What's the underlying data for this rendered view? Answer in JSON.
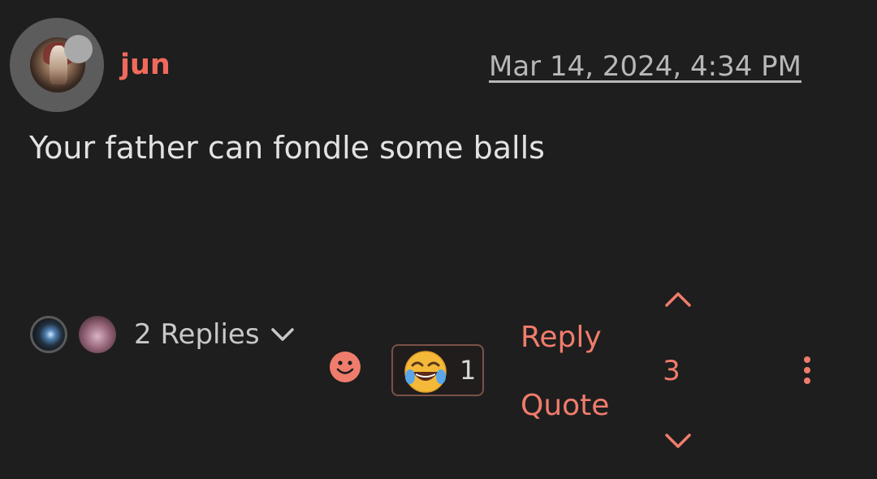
{
  "post": {
    "author": "jun",
    "timestamp": "Mar 14, 2024, 4:34 PM",
    "body": "Your father can fondle some balls"
  },
  "replies": {
    "label": "2 Replies",
    "avatar_count": 2
  },
  "reactions": {
    "add_icon": "smiley-icon",
    "items": [
      {
        "emoji": "face-with-tears-of-joy",
        "count": "1"
      }
    ]
  },
  "actions": {
    "reply_label": "Reply",
    "quote_label": "Quote"
  },
  "votes": {
    "score": "3"
  },
  "colors": {
    "accent": "#f07c6c",
    "username": "#f06a5c",
    "background": "#1e1e1e",
    "text": "#e2e2e2",
    "muted": "#b8b8b8"
  }
}
